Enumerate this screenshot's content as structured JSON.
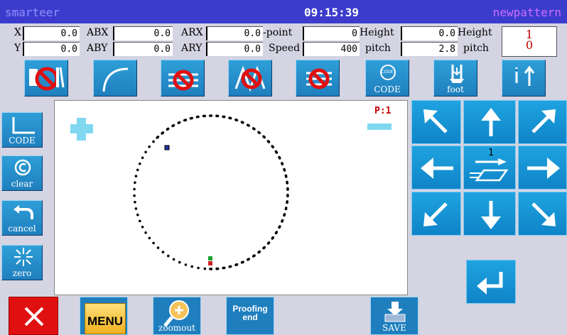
{
  "header": {
    "app_name": "smarteer",
    "time": "09:15:39",
    "pattern_name": "newpattern"
  },
  "readout": {
    "row1": [
      {
        "label": "X",
        "value": "0.0"
      },
      {
        "label": "ABX",
        "value": "0.0"
      },
      {
        "label": "ARX",
        "value": "0.0"
      },
      {
        "label": "-point",
        "value": "0"
      },
      {
        "label": "Height",
        "value": "0.0"
      },
      {
        "label": "Height",
        "value": ""
      }
    ],
    "row2": [
      {
        "label": "Y",
        "value": "0.0"
      },
      {
        "label": "ABY",
        "value": "0.0"
      },
      {
        "label": "ARY",
        "value": "0.0"
      },
      {
        "label": "Speed",
        "value": "400"
      },
      {
        "label": "pitch",
        "value": "2.8"
      },
      {
        "label": "pitch",
        "value": ""
      }
    ],
    "counter": {
      "top": "1",
      "bottom": "0"
    }
  },
  "toolbar": {
    "items": [
      {
        "name": "no-needle",
        "label": ""
      },
      {
        "name": "arc",
        "label": ""
      },
      {
        "name": "no-feed",
        "label": ""
      },
      {
        "name": "no-zigzag",
        "label": ""
      },
      {
        "name": "no-sew",
        "label": ""
      },
      {
        "name": "code",
        "label": "CODE",
        "icon_text": "CODE"
      },
      {
        "name": "foot",
        "label": "foot"
      },
      {
        "name": "needle-up",
        "label": ""
      }
    ]
  },
  "left_panel": {
    "items": [
      {
        "name": "code",
        "label": "CODE"
      },
      {
        "name": "clear",
        "label": "clear"
      },
      {
        "name": "cancel",
        "label": "cancel"
      },
      {
        "name": "zero",
        "label": "zero"
      }
    ]
  },
  "canvas": {
    "page_indicator": "P:1"
  },
  "direction_pad": {
    "center_speed": "1"
  },
  "bottom_bar": {
    "zoomout_label": "zoomout",
    "menu_label": "MENU",
    "proofing_label_1": "Proofing",
    "proofing_label_2": "end",
    "save_label": "SAVE"
  },
  "colors": {
    "title_bg": "#3b3ccc",
    "accent": "#1f90d0",
    "stitch": "#000000",
    "close": "#e01010"
  }
}
